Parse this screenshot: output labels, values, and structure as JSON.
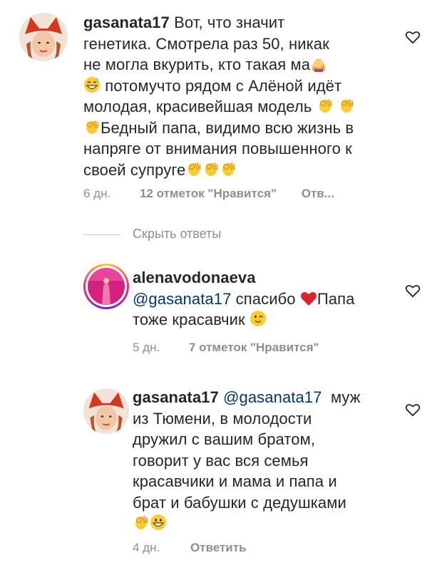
{
  "comments": [
    {
      "username": "gasanata17",
      "text_lines": [
        "Вот, что значит",
        "генетика. Смотрела раз 50, никак",
        "не могла вкурить, кто такая ма",
        "потомучто рядом с Алёной идёт",
        "молодая, красивейшая модель",
        "Бедный папа, видимо всю жизнь в",
        "напряге от внимания повышенного к",
        "своей супруге"
      ],
      "time": "6 дн.",
      "likes": "12 отметок \"Нравится\"",
      "reply": "Отв..."
    },
    {
      "username": "alenavodonaeva",
      "mention": "@gasanata17",
      "text_a": "спасибо",
      "text_b": "Папа",
      "text_line2": "тоже красавчик",
      "time": "5 дн.",
      "likes": "7 отметок \"Нравится\""
    },
    {
      "username": "gasanata17",
      "mention": "@gasanata17",
      "text_first": "муж",
      "text_lines": [
        "из  Тюмени, в молодости",
        "дружил с вашим братом,",
        "говорит у вас вся семья",
        "красавчики и мама и папа и",
        "брат и бабушки с дедушками"
      ],
      "time": "4 дн.",
      "reply": "Ответить"
    }
  ],
  "hide_replies": "Скрыть ответы",
  "icons": {
    "heart_outline": "heart-icon",
    "ok_hand": "ok-hand-emoji",
    "woman_facepalm": "woman-facepalming-emoji",
    "sweat_smile": "grinning-sweat-emoji",
    "red_heart": "red-heart-emoji",
    "wink": "winking-face-emoji",
    "grin": "grinning-face-emoji"
  },
  "colors": {
    "text": "#262626",
    "meta": "#8e8e8e",
    "mention": "#00376b",
    "accent_red": "#ed4956"
  }
}
